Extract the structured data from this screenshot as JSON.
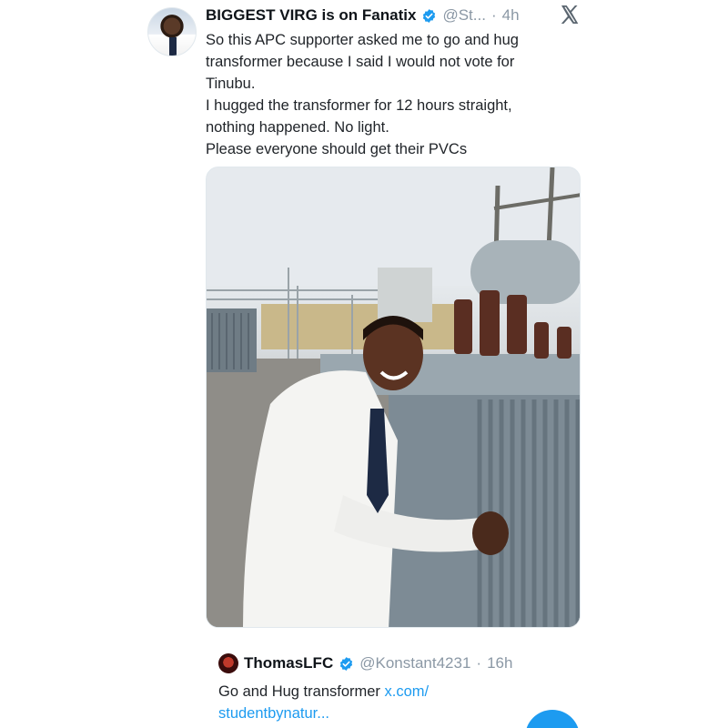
{
  "tweet": {
    "display_name": "BIGGEST VIRG is on Fanatix",
    "handle": "@St...",
    "separator": "·",
    "time": "4h",
    "text_lines": [
      "So this APC supporter asked me to go and hug",
      "transformer because I said I would not vote for",
      "Tinubu.",
      "I hugged the transformer for 12 hours straight,",
      "nothing happened.  No light.",
      "Please everyone should get their PVCs"
    ]
  },
  "quote": {
    "display_name": "ThomasLFC",
    "handle": "@Konstant4231",
    "separator": "·",
    "time": "16h",
    "text": "Go and Hug transformer ",
    "link_line1": "x.com/",
    "link_line2": "studentbynatur..."
  },
  "icons": {
    "verified": "verified-badge-icon",
    "platform_logo": "x-logo-icon"
  },
  "colors": {
    "link": "#1d9bf0",
    "verified": "#1d9bf0",
    "secondary_text": "#8b98a5"
  }
}
